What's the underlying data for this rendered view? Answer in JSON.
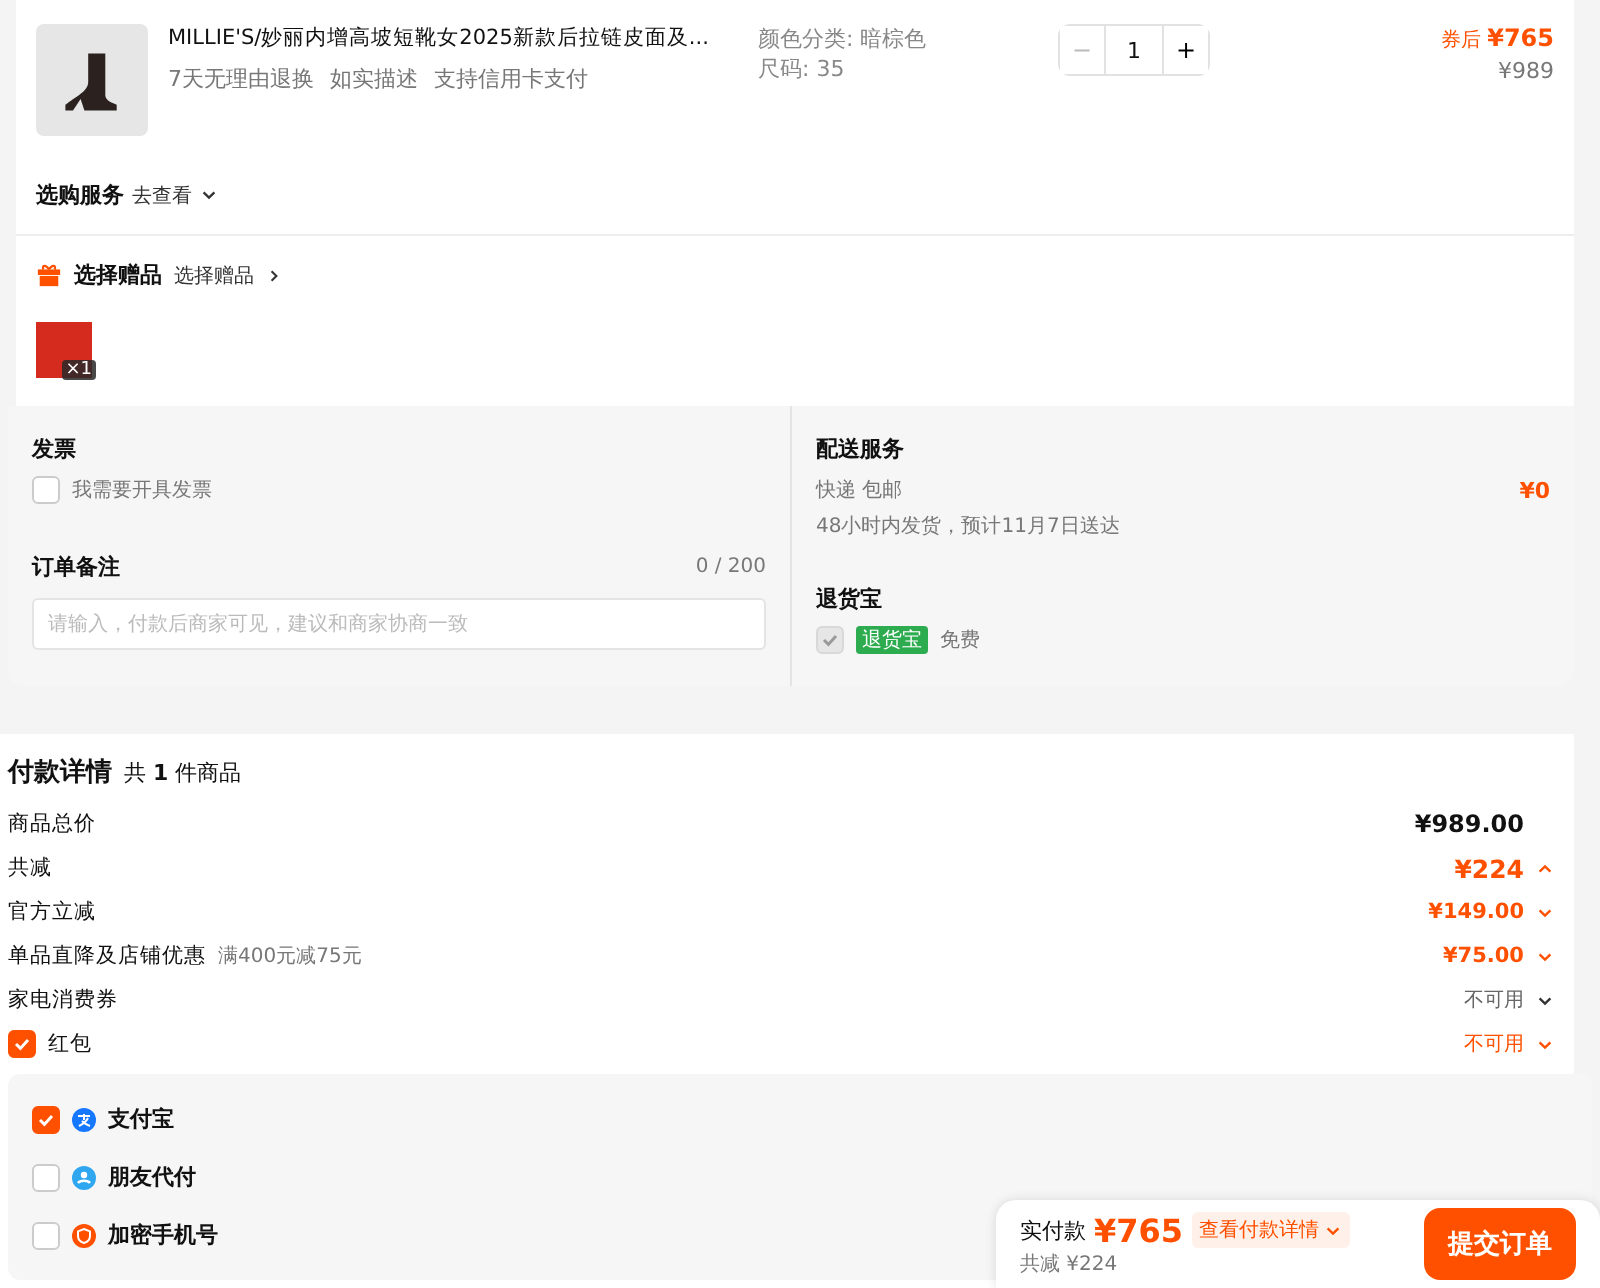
{
  "product": {
    "title": "MILLIE'S/妙丽内增高坡短靴女2025新款后拉链皮面及...",
    "tags": [
      "7天无理由退换",
      "如实描述",
      "支持信用卡支付"
    ],
    "specs": [
      "颜色分类: 暗棕色",
      "尺码: 35"
    ],
    "quantity": "1",
    "minus": "−",
    "plus": "+",
    "coupon_label": "券后",
    "price": "¥765",
    "original_price": "¥989",
    "service_label": "选购服务",
    "service_link": "去查看"
  },
  "gift": {
    "title": "选择赠品",
    "link": "选择赠品",
    "count": "×1"
  },
  "invoice": {
    "title": "发票",
    "option": {
      "label": "我需要开具发票",
      "checked": false
    }
  },
  "note": {
    "title": "订单备注",
    "counter": "0 / 200",
    "placeholder": "请输入，付款后商家可见，建议和商家协商一致"
  },
  "delivery": {
    "title": "配送服务",
    "method": "快递 包邮",
    "eta": "48小时内发货，预计11月7日送达",
    "fee": "¥0"
  },
  "return_service": {
    "title": "退货宝",
    "checked": true,
    "badge": "退货宝",
    "text": "免费"
  },
  "payment_details": {
    "title": "付款详情",
    "summary": "共 **1** 件商品",
    "rows": [
      {
        "kind": "total",
        "label": "商品总价",
        "amount": "¥989.00"
      },
      {
        "kind": "discount_total",
        "label": "共减",
        "amount": "¥224",
        "expanded": true
      },
      {
        "kind": "discount",
        "label": "官方立减",
        "amount": "¥149.00",
        "expanded": false
      },
      {
        "kind": "discount",
        "label": "单品直降及店铺优惠",
        "note": "满400元减75元",
        "amount": "¥75.00",
        "expanded": false
      },
      {
        "kind": "unavailable",
        "label": "家电消费券",
        "amount": "不可用",
        "expanded": false
      },
      {
        "kind": "checkbox",
        "label": "红包",
        "checked": true,
        "amount": "不可用",
        "expanded": false
      }
    ]
  },
  "payment_methods": [
    {
      "kind": "alipay",
      "name": "支付宝",
      "selected": true
    },
    {
      "kind": "friend",
      "name": "朋友代付",
      "selected": false
    },
    {
      "kind": "phone",
      "name": "加密手机号",
      "selected": false
    }
  ],
  "bottom_bar": {
    "label": "实付款",
    "amount": "¥765",
    "details_link": "查看付款详情",
    "reduced": "共减 ¥224",
    "submit": "提交订单"
  }
}
